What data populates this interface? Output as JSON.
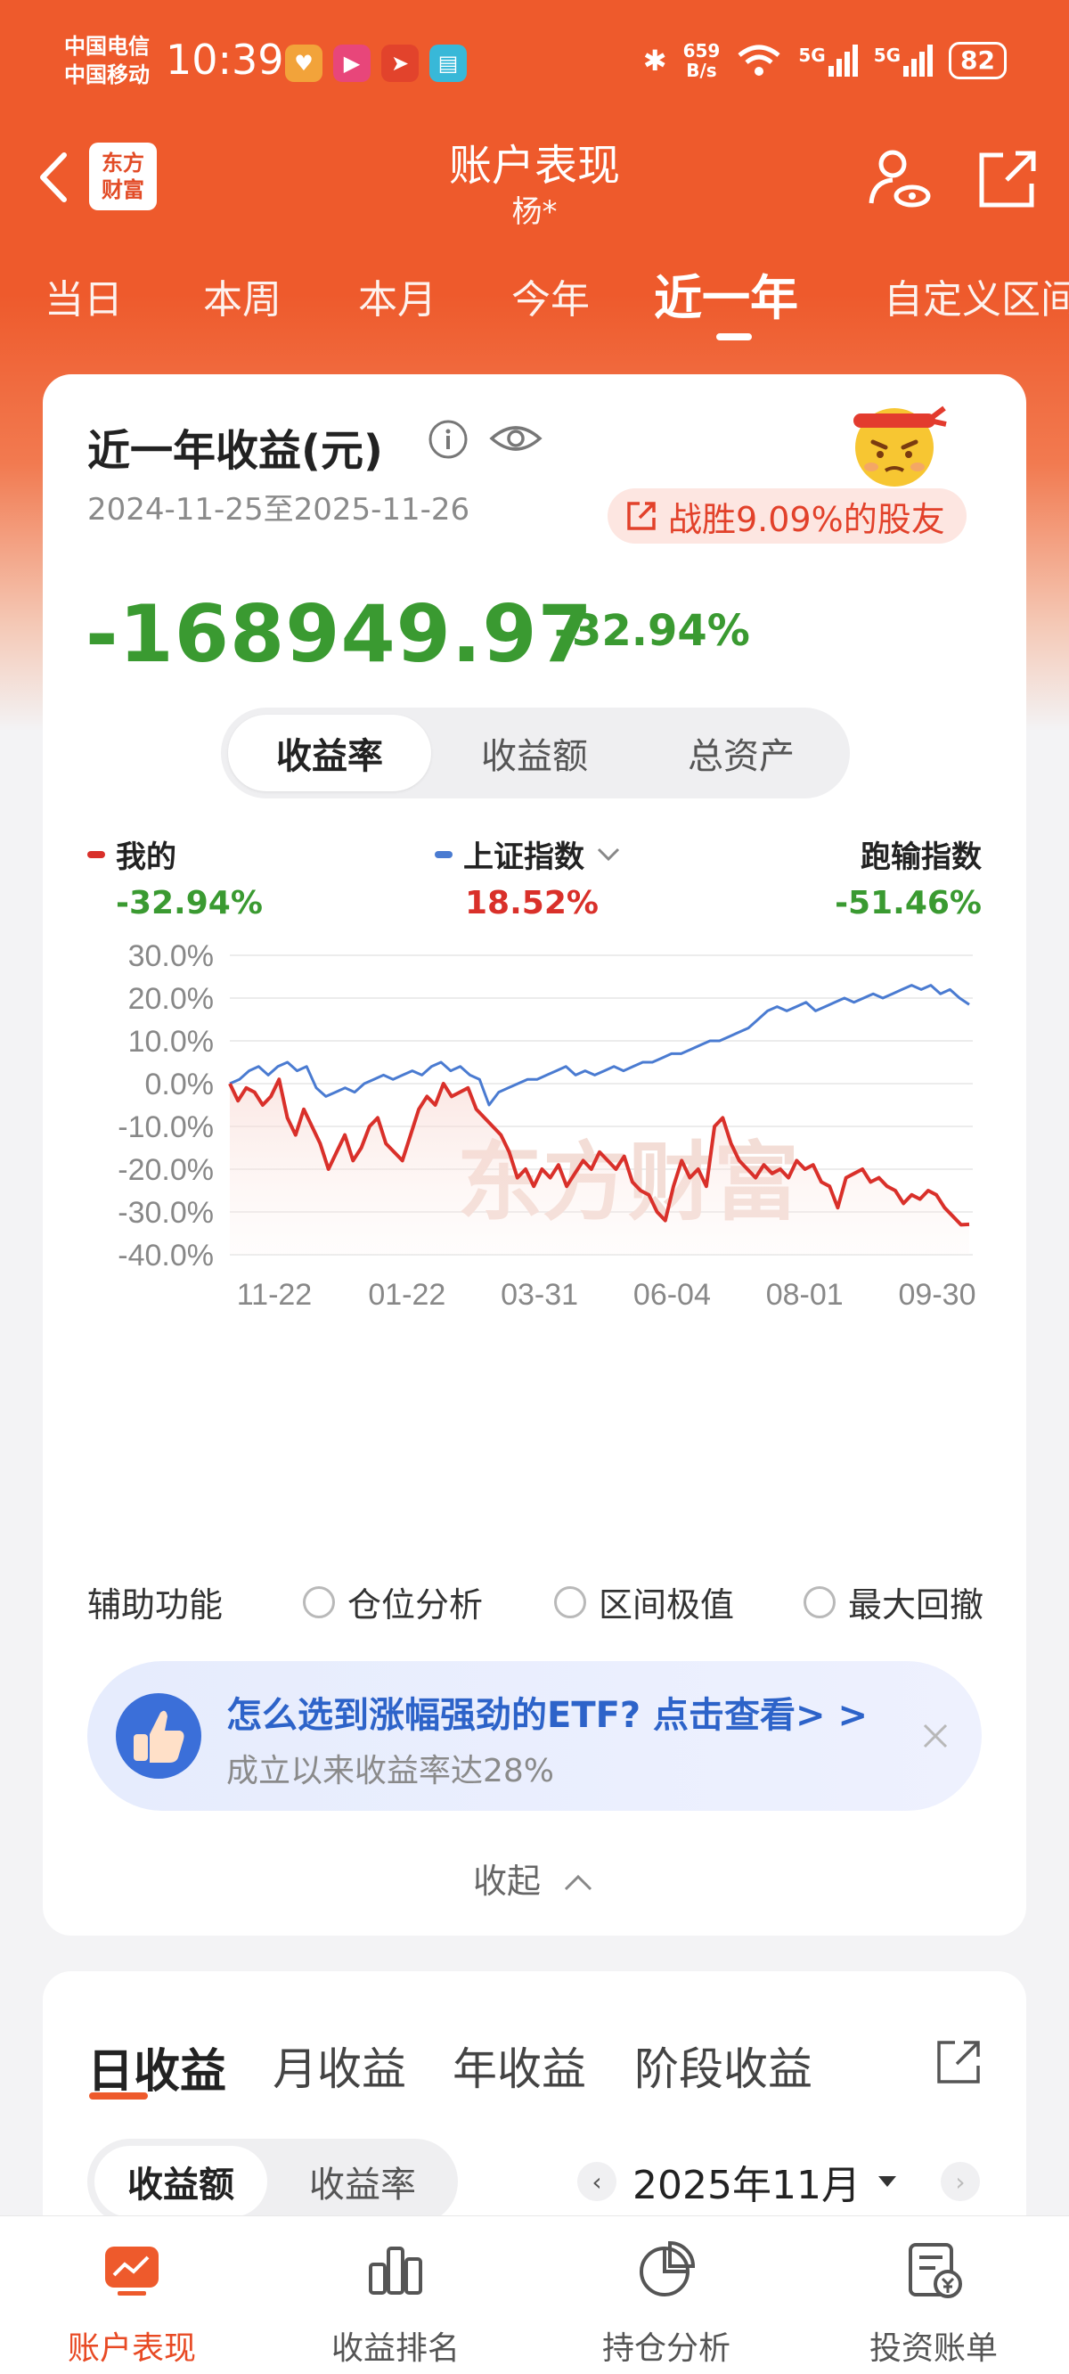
{
  "status_bar": {
    "carrier_1": "中国电信",
    "carrier_2": "中国移动",
    "time": "10:39",
    "net_speed_value": "659",
    "net_speed_unit": "B/s",
    "signal_1": "5G",
    "signal_2": "5G",
    "battery": "82"
  },
  "header": {
    "logo_text_1": "东方",
    "logo_text_2": "财富",
    "title": "账户表现",
    "subtitle": "杨*"
  },
  "period_tabs": [
    "当日",
    "本周",
    "本月",
    "今年",
    "近一年",
    "自定义区间"
  ],
  "summary": {
    "title": "近一年收益(元)",
    "date_range": "2024-11-25至2025-11-26",
    "beat_text": "战胜9.09%的股友",
    "total_profit": "-168949.97",
    "total_pct": "-32.94%"
  },
  "metric_toggle": {
    "options": [
      "收益率",
      "收益额",
      "总资产"
    ],
    "selected": "收益率"
  },
  "legend": {
    "mine_label": "我的",
    "mine_value": "-32.94%",
    "index_label": "上证指数",
    "index_value": "18.52%",
    "gap_label": "跑输指数",
    "gap_value": "-51.46%"
  },
  "colors": {
    "brand": "#ee5a2c",
    "mine": "#d9302a",
    "index": "#4a7bd1",
    "gain": "#d9302a",
    "loss": "#3a9a31"
  },
  "chart_data": {
    "type": "line",
    "x_tick_labels": [
      "11-22",
      "01-22",
      "03-31",
      "06-04",
      "08-01",
      "09-30"
    ],
    "y_ticks": [
      "30.0%",
      "20.0%",
      "10.0%",
      "0.0%",
      "-10.0%",
      "-20.0%",
      "-30.0%",
      "-40.0%"
    ],
    "ylim": [
      -40,
      30
    ],
    "watermark": "东方财富",
    "series": [
      {
        "name": "我的",
        "color": "#d9302a",
        "values": [
          0,
          -4,
          -1,
          -2,
          -5,
          -3,
          1,
          -8,
          -12,
          -6,
          -10,
          -14,
          -20,
          -16,
          -12,
          -18,
          -15,
          -10,
          -8,
          -14,
          -16,
          -18,
          -12,
          -6,
          -3,
          -5,
          0,
          -3,
          -2,
          -1,
          -6,
          -8,
          -10,
          -12,
          -16,
          -22,
          -20,
          -24,
          -20,
          -22,
          -19,
          -24,
          -21,
          -18,
          -20,
          -16,
          -18,
          -20,
          -17,
          -23,
          -25,
          -26,
          -30,
          -32,
          -24,
          -18,
          -22,
          -20,
          -24,
          -10,
          -8,
          -14,
          -18,
          -20,
          -22,
          -19,
          -21,
          -20,
          -22,
          -18,
          -20,
          -19,
          -23,
          -24,
          -29,
          -22,
          -21,
          -20,
          -23,
          -22,
          -24,
          -25,
          -28,
          -26,
          -27,
          -25,
          -26,
          -29,
          -31,
          -33,
          -32.9
        ]
      },
      {
        "name": "上证指数",
        "color": "#4a7bd1",
        "values": [
          0,
          1,
          3,
          4,
          2,
          4,
          5,
          3,
          4,
          -1,
          -3,
          -2,
          -1,
          -2,
          0,
          1,
          2,
          1,
          2,
          3,
          2,
          4,
          5,
          3,
          4,
          2,
          1,
          -5,
          -2,
          -1,
          0,
          1,
          1,
          2,
          3,
          4,
          2,
          3,
          2,
          3,
          4,
          3,
          4,
          5,
          5,
          6,
          7,
          7,
          8,
          9,
          10,
          10,
          11,
          12,
          13,
          15,
          17,
          18,
          17,
          18,
          19,
          17,
          18,
          19,
          20,
          19,
          20,
          21,
          20,
          21,
          22,
          23,
          22,
          23,
          21,
          22,
          20,
          18.5
        ]
      }
    ]
  },
  "aux": {
    "label": "辅助功能",
    "options": [
      "仓位分析",
      "区间极值",
      "最大回撤"
    ]
  },
  "promo": {
    "title": "怎么选到涨幅强劲的ETF? 点击查看> >",
    "subtitle": "成立以来收益率达28%"
  },
  "collapse_label": "收起",
  "profit_tabs": [
    "日收益",
    "月收益",
    "年收益",
    "阶段收益"
  ],
  "profit_toggle": [
    "收益额",
    "收益率"
  ],
  "month_label": "2025年11月",
  "bottom_nav": [
    "账户表现",
    "收益排名",
    "持仓分析",
    "投资账单"
  ]
}
